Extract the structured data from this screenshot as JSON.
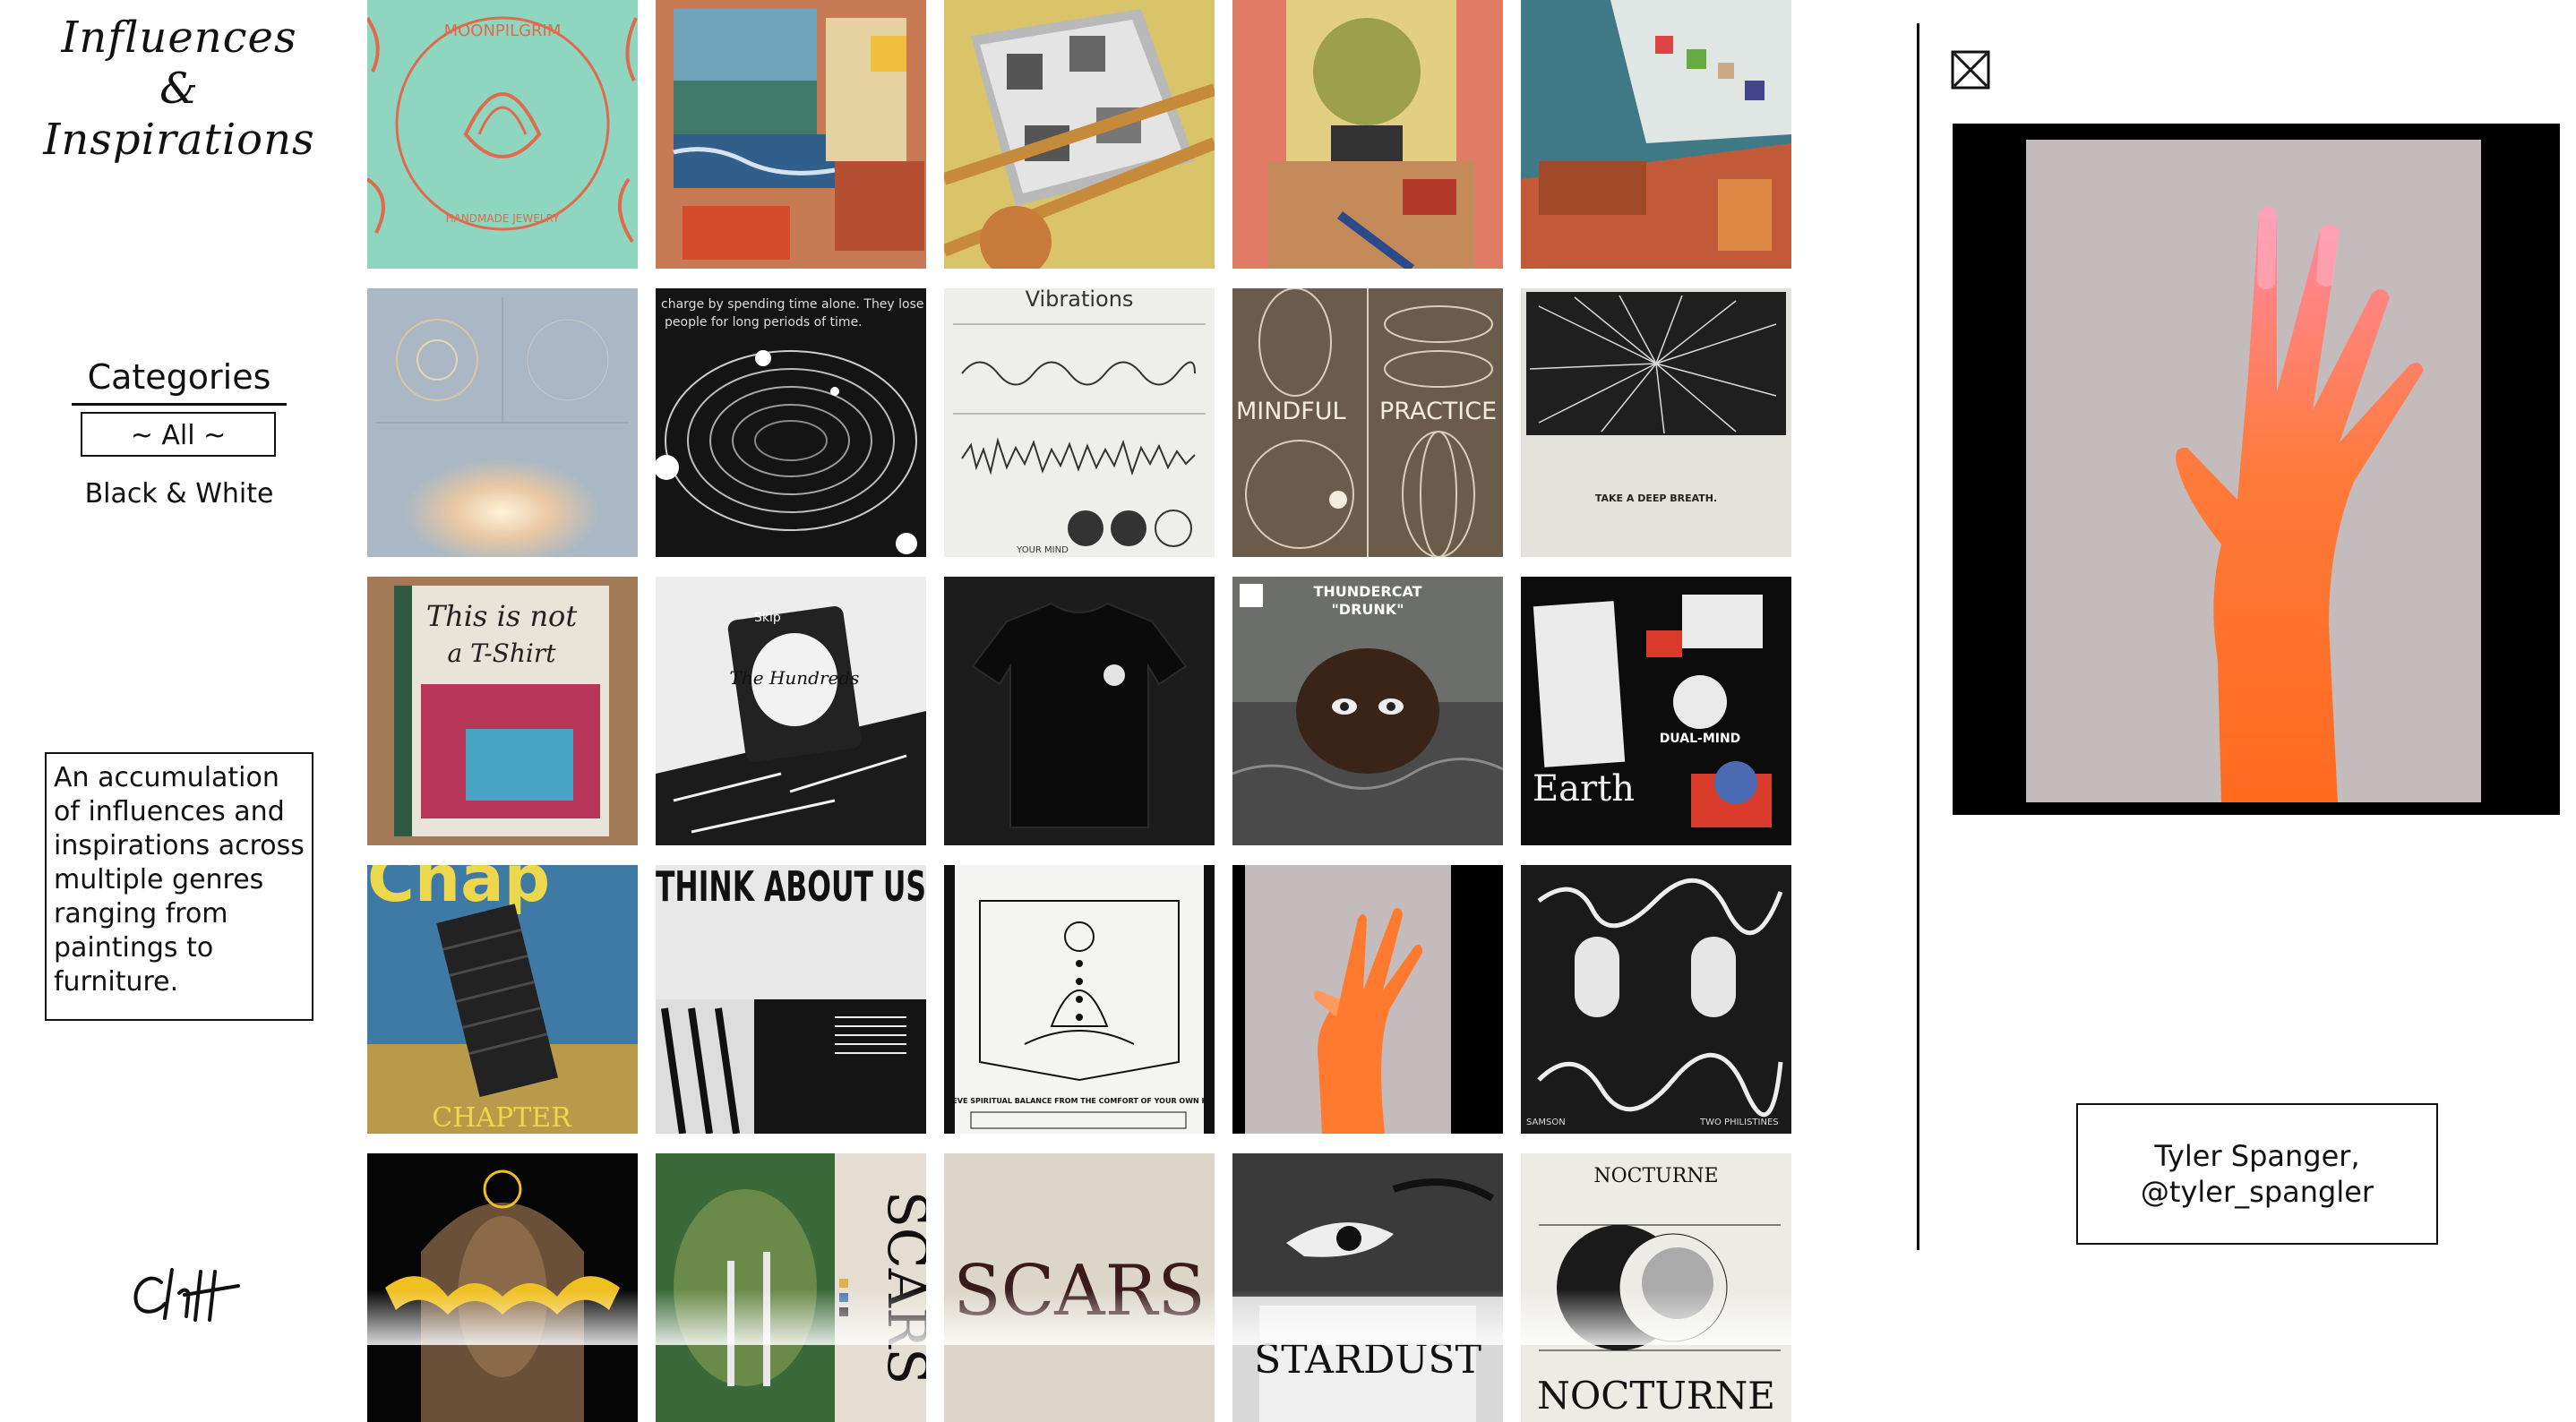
{
  "sidebar": {
    "title_line1": "Influences &",
    "title_line2": "Inspirations",
    "categories_heading": "Categories",
    "categories": [
      {
        "label": "~ All ~",
        "selected": true
      },
      {
        "label": "Black & White",
        "selected": false
      }
    ],
    "description": "An accumulation of influences and inspirations across multiple genres ranging from paintings to furniture.",
    "logo_text": "CH"
  },
  "grid": {
    "tiles": [
      {
        "text": "MOONPILGRIM",
        "sub": "HANDMADE JEWELRY"
      },
      {
        "text": ""
      },
      {
        "text": ""
      },
      {
        "text": ""
      },
      {
        "text": ""
      },
      {
        "text": ""
      },
      {
        "text": "charge by spending time alone. They lose e",
        "sub": "people for long periods of time."
      },
      {
        "text": "Vibrations",
        "sub": "YOUR MIND"
      },
      {
        "text": "MINDFUL",
        "sub": "PRACTICE"
      },
      {
        "text": "TAKE A DEEP BREATH."
      },
      {
        "text": "This is not",
        "sub": "a T-Shirt"
      },
      {
        "text": "The Hundreds",
        "sub": "Skip"
      },
      {
        "text": ""
      },
      {
        "text": "THUNDERCAT",
        "sub": "\"DRUNK\""
      },
      {
        "text": "Earth",
        "sub": "DUAL-MIND"
      },
      {
        "text": "CHAPTER",
        "sub": "Chap"
      },
      {
        "text": "THINK ABOUT US"
      },
      {
        "text": "ACHIEVE SPIRITUAL BALANCE FROM THE COMFORT OF YOUR OWN HOME"
      },
      {
        "text": ""
      },
      {
        "text": "SAMSON",
        "sub": "TWO PHILISTINES"
      },
      {
        "text": ""
      },
      {
        "text": "SCARS"
      },
      {
        "text": "SCARS"
      },
      {
        "text": "STARDUST"
      },
      {
        "text": "NOCTURNE",
        "sub": "NOCTURNE"
      }
    ]
  },
  "panel": {
    "credit": "Tyler Spanger,\n@tyler_spangler",
    "close_icon": "close-x-icon"
  },
  "colors": {
    "accent_orange": "#ff7a2e",
    "preview_bg": "#000000",
    "preview_inner": "#c4bcbc"
  }
}
